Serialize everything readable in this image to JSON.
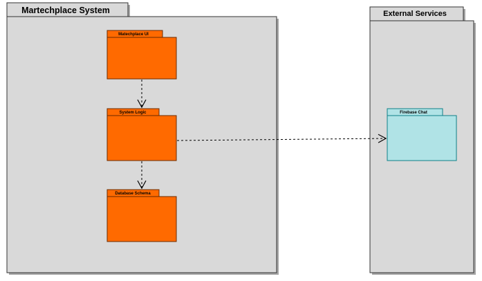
{
  "diagram": {
    "colors": {
      "outer_fill": "#d9d9d9",
      "outer_stroke": "#333333",
      "shadow": "#a6a6a6",
      "orange_fill": "#ff6a00",
      "orange_stroke": "#6b2a00",
      "cyan_fill": "#b0e3e6",
      "cyan_stroke": "#0e8088",
      "edge": "#000000"
    },
    "containers": [
      {
        "id": "martechplace-system",
        "label": "Martechplace System"
      },
      {
        "id": "external-services",
        "label": "External Services"
      }
    ],
    "packages": [
      {
        "id": "martechplace-ui",
        "label": "Matechplace UI",
        "style": "orange",
        "container": "martechplace-system"
      },
      {
        "id": "system-logic",
        "label": "System Logic",
        "style": "orange",
        "container": "martechplace-system"
      },
      {
        "id": "database-schema",
        "label": "Database Schema",
        "style": "orange",
        "container": "martechplace-system"
      },
      {
        "id": "firebase-chat",
        "label": "Firebase Chat",
        "style": "cyan",
        "container": "external-services"
      }
    ],
    "dependencies": [
      {
        "from": "martechplace-ui",
        "to": "system-logic",
        "style": "dashed-open-arrow"
      },
      {
        "from": "system-logic",
        "to": "database-schema",
        "style": "dashed-open-arrow"
      },
      {
        "from": "system-logic",
        "to": "firebase-chat",
        "style": "dashed-open-arrow"
      }
    ]
  }
}
